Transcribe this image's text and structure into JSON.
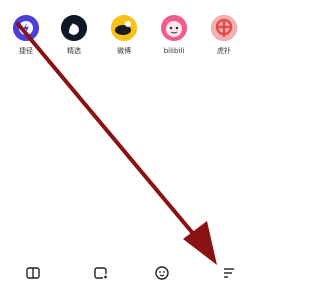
{
  "apps": [
    {
      "label": "捷径",
      "icon": "shortcuts-icon",
      "color": "#4a3fd6"
    },
    {
      "label": "精选",
      "icon": "picks-icon",
      "color": "#101828"
    },
    {
      "label": "微博",
      "icon": "weibo-icon",
      "color": "#f6c21a"
    },
    {
      "label": "bilibili",
      "icon": "bilibili-icon",
      "color": "#f25d8e"
    },
    {
      "label": "虎扑",
      "icon": "hupu-icon",
      "color": "#e64a4a"
    }
  ],
  "bottom_toolbar": [
    {
      "icon": "book-icon"
    },
    {
      "icon": "tabs-icon"
    },
    {
      "icon": "smiley-icon"
    },
    {
      "icon": "menu-icon"
    }
  ],
  "annotation": {
    "icon": "arrow-icon",
    "color": "#8b1212"
  }
}
